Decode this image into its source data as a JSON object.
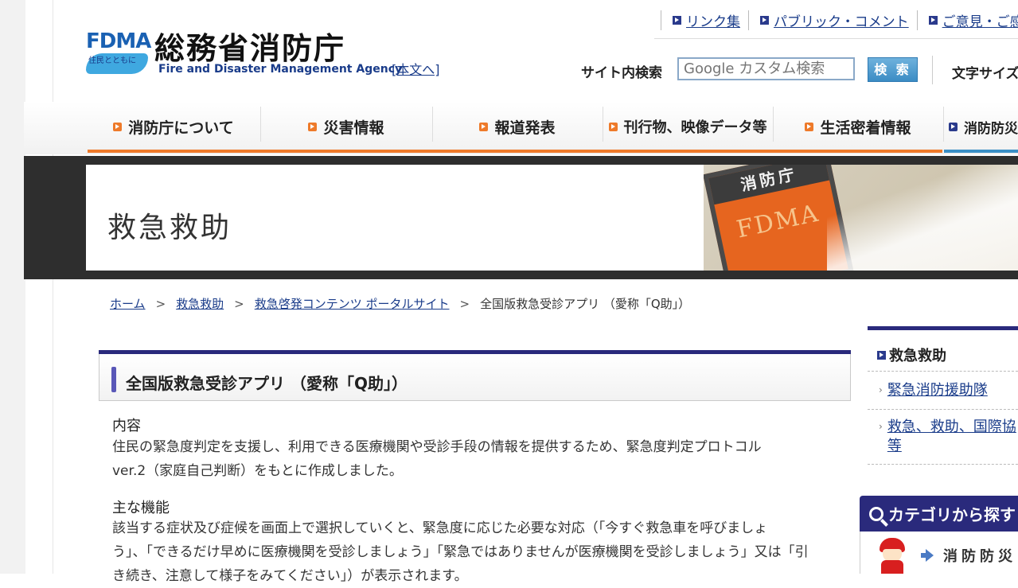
{
  "header": {
    "logo_text": "FDMA",
    "logo_tagline": "住民とともに",
    "agency_name": "総務省消防庁",
    "agency_en": "Fire and Disaster Management Agency",
    "skip_link": "[本文へ]",
    "util_links": [
      "リンク集",
      "パブリック・コメント",
      "ご意見・ご感想"
    ],
    "search_label": "サイト内検索",
    "search_placeholder": "Google カスタム検索",
    "search_button": "検 索",
    "font_size_label": "文字サイズ"
  },
  "nav": {
    "items": [
      "消防庁について",
      "災害情報",
      "報道発表",
      "刊行物、映像データ等",
      "生活密着情報",
      "消防防災"
    ]
  },
  "banner": {
    "title": "救急救助",
    "badge_top": "消防庁",
    "badge_text": "FDMA"
  },
  "breadcrumb": {
    "items": [
      "ホーム",
      "救急救助",
      "救急啓発コンテンツ ポータルサイト"
    ],
    "current": "全国版救急受診アプリ （愛称「Q助」）",
    "separator": ">"
  },
  "article": {
    "title": "全国版救急受診アプリ （愛称「Q助」）",
    "sections": [
      {
        "heading": "内容",
        "lines": [
          "住民の緊急度判定を支援し、利用できる医療機関や受診手段の情報を提供するため、緊急度判定プロトコル",
          "ver.2（家庭自己判断）をもとに作成しました。"
        ]
      },
      {
        "heading": "主な機能",
        "lines": [
          "該当する症状及び症候を画面上で選択していくと、緊急度に応じた必要な対応（「今すぐ救急車を呼びましょ",
          "う」、「できるだけ早めに医療機関を受診しましょう」「緊急ではありませんが医療機関を受診しましょう」又は「引",
          "き続き、注意して様子をみてください」）が表示されます。"
        ]
      }
    ]
  },
  "sidebar": {
    "heading": "救急救助",
    "links": [
      "緊急消防援助隊",
      "救急、救助、国際協",
      "等"
    ],
    "category_title": "カテゴリから探す",
    "category_link": "消防防災"
  },
  "colors": {
    "navy": "#2a2a7c",
    "orange": "#ee7a2a",
    "link": "#1a3c8a"
  }
}
